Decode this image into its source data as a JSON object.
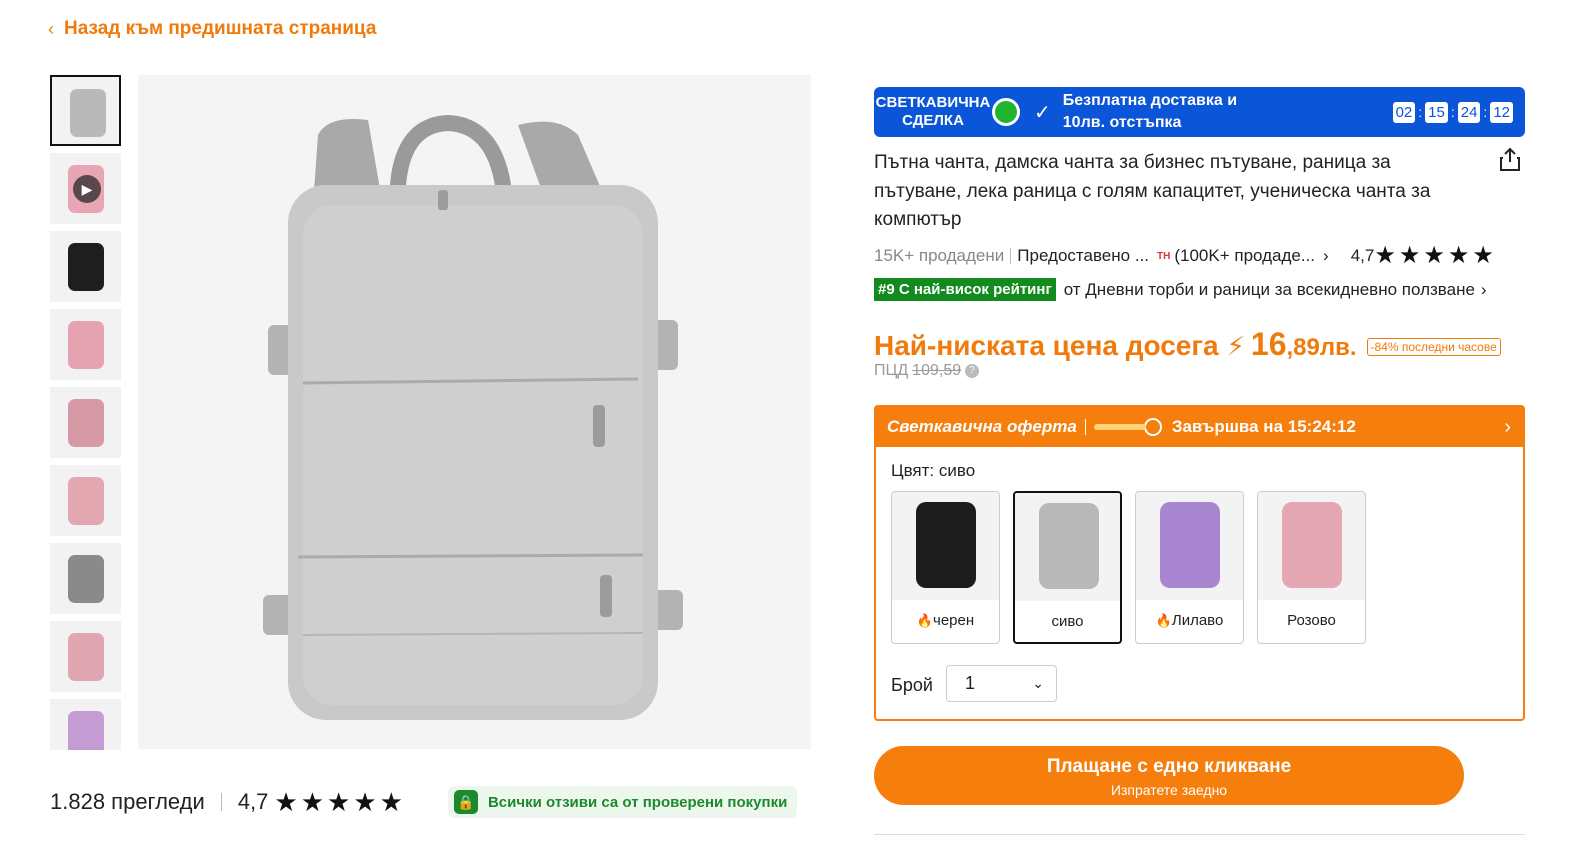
{
  "back": {
    "label": "Назад към предишната страница"
  },
  "gallery": {
    "thumbnails": [
      {
        "color": "#b9b9b9"
      },
      {
        "color": "#e8a6b4",
        "video": true
      },
      {
        "color": "#1e1e1e"
      },
      {
        "color": "#e5a2b0"
      },
      {
        "color": "#d69aa6"
      },
      {
        "color": "#e3a7b2"
      },
      {
        "color": "#8a8a8a"
      },
      {
        "color": "#e0a6b2"
      },
      {
        "color": "#c49bd3"
      }
    ],
    "main_color": "#c9c9c9"
  },
  "reviews": {
    "count": "1.828 прегледи",
    "rating": "4,7",
    "verified": "Всички отзиви са от проверени покупки"
  },
  "flash": {
    "title_line1": "СВЕТКАВИЧНА",
    "title_line2": "СДЕЛКА",
    "text_line1": "Безплатна доставка и",
    "text_line2": "10лв. отстъпка",
    "timer": [
      "02",
      "15",
      "24",
      "12"
    ]
  },
  "product": {
    "title": "Пътна чанта, дамска чанта за бизнес пътуване, раница за пътуване, лека раница с голям капацитет, ученическа чанта за компютър",
    "sold": "15K+ продадени",
    "provided": "Предоставено ...",
    "store_badge": "TH",
    "store_sold": "(100K+ продаде...",
    "rating": "4,7",
    "rank_badge": "#9 С най-висок рейтинг",
    "rank_text": "от Дневни торби и раници за всекидневно ползване"
  },
  "price": {
    "label": "Най-ниската цена досега",
    "main": "16",
    "cents": ",89лв.",
    "discount": "-84% последни часове",
    "rrp_label": "ПЦД",
    "rrp_value": "109,59"
  },
  "offer": {
    "title": "Светкавична оферта",
    "ends": "Завършва на 15:24:12",
    "color_label": "Цвят: сиво",
    "swatches": [
      {
        "label": "черен",
        "hot": true,
        "color": "#1c1c1c"
      },
      {
        "label": "сиво",
        "hot": false,
        "color": "#b8b8b8",
        "selected": true
      },
      {
        "label": "Лилаво",
        "hot": true,
        "color": "#a987d0"
      },
      {
        "label": "Розово",
        "hot": false,
        "color": "#e6a7b5"
      }
    ],
    "qty_label": "Брой",
    "qty_value": "1"
  },
  "pay": {
    "label": "Плащане с едно кликване",
    "sub": "Изпратете заедно"
  },
  "colors": {
    "accent": "#f57e0d",
    "flash_blue": "#0a55d8",
    "rank_green": "#128a1e"
  }
}
